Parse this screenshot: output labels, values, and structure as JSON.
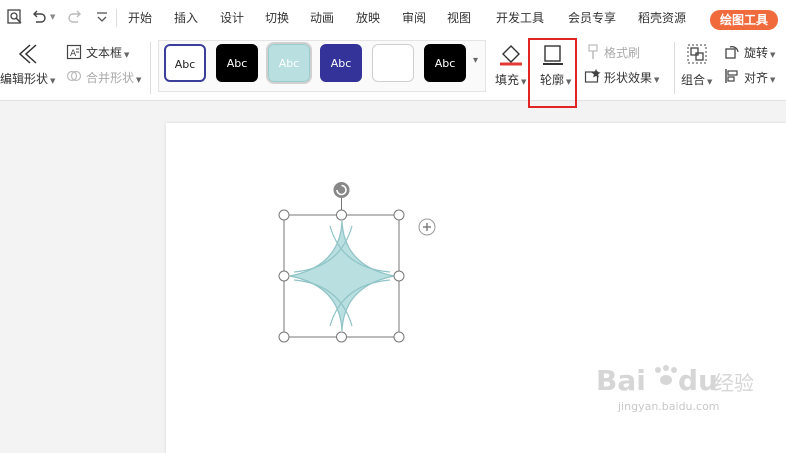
{
  "menubar": {
    "tabs": [
      "开始",
      "插入",
      "设计",
      "切换",
      "动画",
      "放映",
      "审阅",
      "视图",
      "开发工具",
      "会员专享",
      "稻壳资源"
    ],
    "active_tool": "绘图工具"
  },
  "ribbon": {
    "edit_shape": "编辑形状",
    "text_box": "文本框",
    "merge_shape": "合并形状",
    "styles": [
      {
        "label": "Abc",
        "bg": "#ffffff",
        "fg": "#222222",
        "border": "#3a3f9a"
      },
      {
        "label": "Abc",
        "bg": "#000000",
        "fg": "#ffffff",
        "border": "#000000"
      },
      {
        "label": "Abc",
        "bg": "#b9dfe0",
        "fg": "#ffffff",
        "border": "#9ccbcc"
      },
      {
        "label": "Abc",
        "bg": "#333399",
        "fg": "#ffffff",
        "border": "#333399"
      },
      {
        "label": "",
        "bg": "#ffffff",
        "fg": "#222222",
        "border": "#cfcfcf"
      },
      {
        "label": "Abc",
        "bg": "#000000",
        "fg": "#ffffff",
        "border": "#000000"
      }
    ],
    "fill": "填充",
    "outline": "轮廓",
    "format_painter": "格式刷",
    "shape_effect": "形状效果",
    "group": "组合",
    "rotate": "旋转",
    "align": "对齐"
  },
  "colors": {
    "accent": "#f06a3c",
    "highlight_box": "#e02424",
    "shape_fill": "#b9dfe0",
    "shape_stroke": "#8fc3c6"
  },
  "icons": [
    "print-preview-icon",
    "undo-icon",
    "redo-icon",
    "quick-access-dropdown-icon",
    "edit-shape-icon",
    "text-box-icon",
    "merge-shape-icon",
    "fill-icon",
    "outline-icon",
    "format-painter-icon",
    "shape-effect-icon",
    "group-icon",
    "rotate-icon",
    "align-icon",
    "rotate-handle-icon",
    "layout-options-icon"
  ],
  "watermark": {
    "text": "jingyan.baidu.com"
  }
}
